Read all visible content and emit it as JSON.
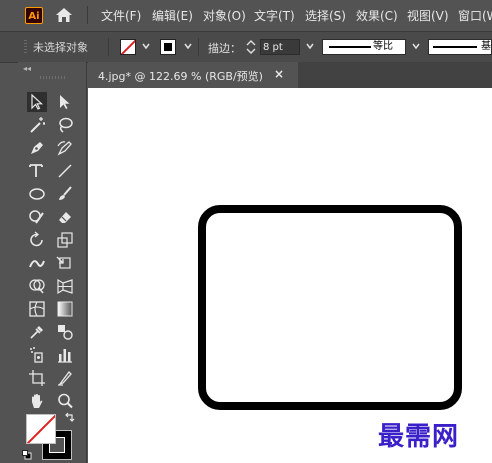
{
  "app": {
    "logo_text": "Ai"
  },
  "menu": [
    "文件(F)",
    "编辑(E)",
    "对象(O)",
    "文字(T)",
    "选择(S)",
    "效果(C)",
    "视图(V)",
    "窗口(W"
  ],
  "control_bar": {
    "selection_status": "未选择对象",
    "stroke_label": "描边：",
    "stroke_weight": "8 pt",
    "profile_label": "等比",
    "brush_label": "基"
  },
  "document_tab": {
    "label": "4.jpg* @ 122.69 % (RGB/预览)",
    "close_symbol": "×"
  },
  "toolbar": {
    "collapse_symbol": "◂◂",
    "tools": [
      "selection-tool",
      "direct-selection-tool",
      "magic-wand-tool",
      "lasso-tool",
      "pen-tool",
      "curvature-tool",
      "type-tool",
      "line-segment-tool",
      "ellipse-tool",
      "paintbrush-tool",
      "shaper-tool",
      "eraser-tool",
      "rotate-tool",
      "scale-tool",
      "width-tool",
      "free-transform-tool",
      "shape-builder-tool",
      "perspective-grid-tool",
      "mesh-tool",
      "gradient-tool",
      "eyedropper-tool",
      "blend-tool",
      "symbol-sprayer-tool",
      "column-graph-tool",
      "artboard-tool",
      "slice-tool",
      "hand-tool",
      "zoom-tool"
    ]
  },
  "colors": {
    "fill": "none",
    "stroke": "#000000",
    "accent_red": "#e02020",
    "watermark": "#3a20c8"
  },
  "canvas": {
    "watermark_text": "最需网"
  }
}
